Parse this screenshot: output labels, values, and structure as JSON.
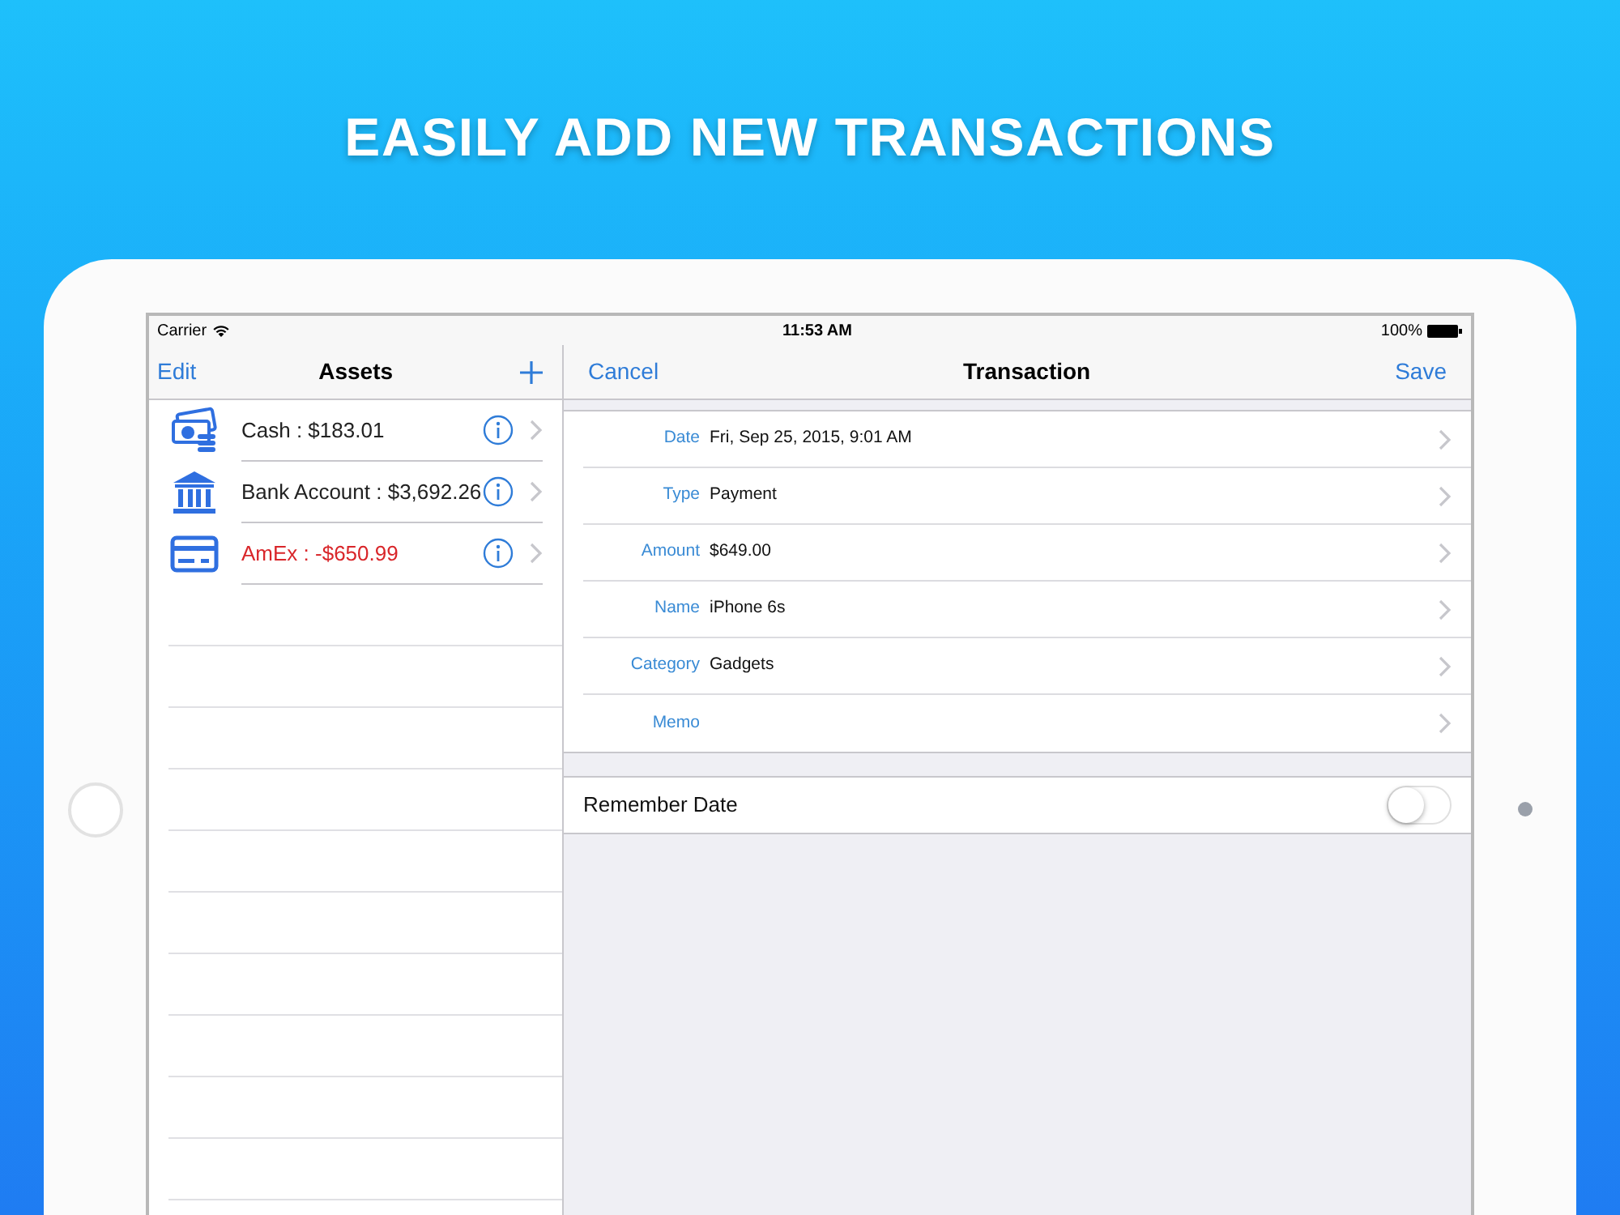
{
  "headline": "EASILY ADD NEW TRANSACTIONS",
  "status_bar": {
    "carrier": "Carrier",
    "time": "11:53 AM",
    "battery": "100%"
  },
  "sidebar": {
    "edit": "Edit",
    "title": "Assets",
    "items": [
      {
        "kind": "cash",
        "label": "Cash : $183.01",
        "negative": false
      },
      {
        "kind": "bank",
        "label": "Bank Account : $3,692.26",
        "negative": false
      },
      {
        "kind": "card",
        "label": "AmEx : -$650.99",
        "negative": true
      }
    ]
  },
  "detail": {
    "cancel": "Cancel",
    "title": "Transaction",
    "save": "Save",
    "fields": [
      {
        "label": "Date",
        "value": "Fri, Sep 25, 2015, 9:01 AM"
      },
      {
        "label": "Type",
        "value": "Payment"
      },
      {
        "label": "Amount",
        "value": "$649.00"
      },
      {
        "label": "Name",
        "value": "iPhone 6s"
      },
      {
        "label": "Category",
        "value": "Gadgets"
      },
      {
        "label": "Memo"
      }
    ],
    "remember_date": {
      "label": "Remember Date",
      "on": false
    }
  }
}
